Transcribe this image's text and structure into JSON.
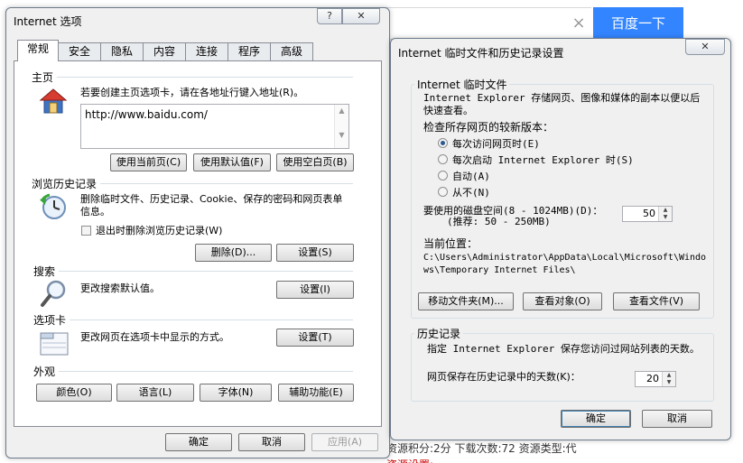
{
  "background": {
    "search_button": "百度一下",
    "clear_icon": "close-icon",
    "line1": "资源积分:2分 下载次数:72 资源类型:代",
    "line2": "资源设置:"
  },
  "ie_options": {
    "title": "Internet 选项",
    "help_button": "?",
    "close_button": "✕",
    "tabs": [
      "常规",
      "安全",
      "隐私",
      "内容",
      "连接",
      "程序",
      "高级"
    ],
    "homepage": {
      "heading": "主页",
      "description": "若要创建主页选项卡，请在各地址行键入地址(R)。",
      "url": "http://www.baidu.com/",
      "use_current": "使用当前页(C)",
      "use_default": "使用默认值(F)",
      "use_blank": "使用空白页(B)"
    },
    "history": {
      "heading": "浏览历史记录",
      "description": "删除临时文件、历史记录、Cookie、保存的密码和网页表单信息。",
      "delete_on_exit": "退出时删除浏览历史记录(W)",
      "delete_button": "删除(D)...",
      "settings_button": "设置(S)"
    },
    "search": {
      "heading": "搜索",
      "description": "更改搜索默认值。",
      "settings_button": "设置(I)"
    },
    "tabs_section": {
      "heading": "选项卡",
      "description": "更改网页在选项卡中显示的方式。",
      "settings_button": "设置(T)"
    },
    "appearance": {
      "heading": "外观",
      "colors": "颜色(O)",
      "languages": "语言(L)",
      "fonts": "字体(N)",
      "accessibility": "辅助功能(E)"
    },
    "ok": "确定",
    "cancel": "取消",
    "apply": "应用(A)"
  },
  "temp_settings": {
    "title": "Internet 临时文件和历史记录设置",
    "close_button": "✕",
    "temp_files": {
      "group_title": "Internet 临时文件",
      "description": "Internet Explorer 存储网页、图像和媒体的副本以便以后快速查看。",
      "check_label": "检查所存网页的较新版本：",
      "options": [
        {
          "label": "每次访问网页时(E)",
          "checked": true
        },
        {
          "label": "每次启动 Internet Explorer 时(S)",
          "checked": false
        },
        {
          "label": "自动(A)",
          "checked": false
        },
        {
          "label": "从不(N)",
          "checked": false
        }
      ],
      "disk_space_label": "要使用的磁盘空间(8 - 1024MB)(D)：",
      "disk_space_hint": "(推荐: 50 - 250MB)",
      "disk_space_value": "50",
      "location_label": "当前位置：",
      "location_path": "C:\\Users\\Administrator\\AppData\\Local\\Microsoft\\Windows\\Temporary Internet Files\\",
      "move_folder": "移动文件夹(M)...",
      "view_objects": "查看对象(O)",
      "view_files": "查看文件(V)"
    },
    "history": {
      "group_title": "历史记录",
      "description": "指定 Internet Explorer 保存您访问过网站列表的天数。",
      "days_label": "网页保存在历史记录中的天数(K)：",
      "days_value": "20"
    },
    "ok": "确定",
    "cancel": "取消"
  }
}
